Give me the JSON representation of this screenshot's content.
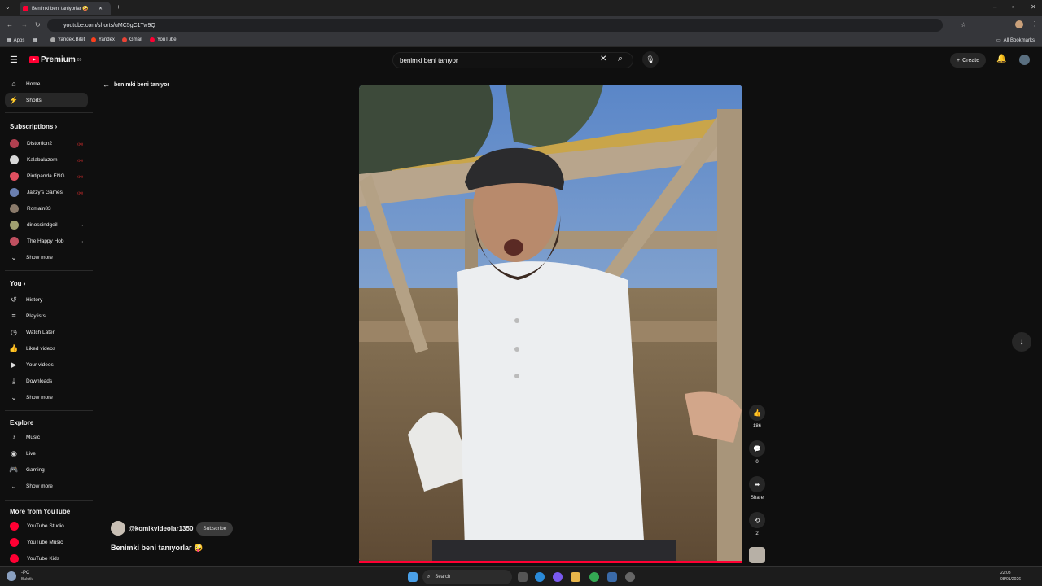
{
  "browser": {
    "tab_title": "Benimki beni taniyorlar 🤪",
    "url": "youtube.com/shorts/uMC5gC1Tw9Q",
    "bookmarks": [
      "Apps",
      "Yandex.Bilet",
      "Yandex",
      "Gmail",
      "YouTube"
    ],
    "all_bookmarks": "All Bookmarks"
  },
  "header": {
    "logo": "Premium",
    "logo_sup": "09",
    "search_value": "benimki beni tanıyor",
    "create_label": "Create"
  },
  "sidebar": {
    "main": [
      {
        "label": "Home",
        "icon": "home-icon"
      },
      {
        "label": "Shorts",
        "icon": "shorts-icon"
      }
    ],
    "subscriptions_title": "Subscriptions",
    "subscriptions": [
      {
        "label": "Distortion2",
        "color": "#b04050"
      },
      {
        "label": "Kalabalazom",
        "color": "#d8d8d8"
      },
      {
        "label": "Pintipanda ENG",
        "color": "#e05060"
      },
      {
        "label": "Jazzy's Games",
        "color": "#6a7fb0"
      },
      {
        "label": "Romain83",
        "color": "#8a7a6a"
      },
      {
        "label": "dinossindgeil",
        "color": "#a0a070"
      },
      {
        "label": "The Happy Hob",
        "color": "#c05060"
      }
    ],
    "sub_show_more": "Show more",
    "you_title": "You",
    "you": [
      {
        "label": "History",
        "icon": "history-icon"
      },
      {
        "label": "Playlists",
        "icon": "playlists-icon"
      },
      {
        "label": "Watch Later",
        "icon": "clock-icon"
      },
      {
        "label": "Liked videos",
        "icon": "like-icon"
      },
      {
        "label": "Your videos",
        "icon": "video-icon"
      },
      {
        "label": "Downloads",
        "icon": "download-icon"
      }
    ],
    "you_show_more": "Show more",
    "explore_title": "Explore",
    "explore": [
      {
        "label": "Music",
        "icon": "music-icon"
      },
      {
        "label": "Live",
        "icon": "live-icon"
      },
      {
        "label": "Gaming",
        "icon": "gaming-icon"
      }
    ],
    "explore_show_more": "Show more",
    "more_title": "More from YouTube",
    "more": [
      {
        "label": "YouTube Studio"
      },
      {
        "label": "YouTube Music"
      },
      {
        "label": "YouTube Kids"
      }
    ]
  },
  "short": {
    "back_label": "benimki beni tanıyor",
    "channel": "@komikvideolar1350",
    "subscribe": "Subscribe",
    "title": "Benimki beni tanıyorlar 🤪",
    "likes": "186",
    "comments": "0",
    "share": "Share",
    "remix": "2",
    "progress": 1.0
  },
  "taskbar": {
    "weather_temp": "-PC",
    "weather_desc": "Bulutlu",
    "search": "Search",
    "time": "22:08",
    "date": "08/01/2026"
  }
}
